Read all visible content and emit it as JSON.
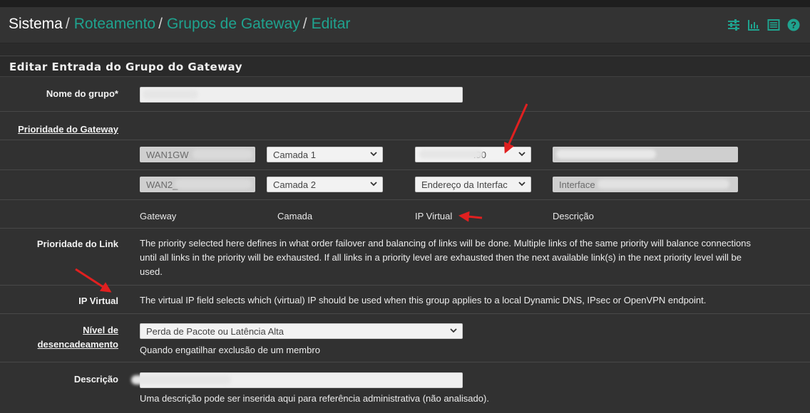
{
  "breadcrumb": {
    "root": "Sistema",
    "items": [
      "Roteamento",
      "Grupos de Gateway",
      "Editar"
    ],
    "separator": "/"
  },
  "header_icons": [
    "sliders-icon",
    "bar-chart-icon",
    "list-icon",
    "help-icon"
  ],
  "colors": {
    "accent": "#1fa38f",
    "arrow": "#e02020",
    "panel": "#2f2f2f"
  },
  "panel": {
    "title": "Editar Entrada do Grupo do Gateway",
    "group_name": {
      "label": "Nome do grupo*",
      "value": ""
    },
    "gateway_priority": {
      "label": "Prioridade do Gateway",
      "rows": [
        {
          "gateway": "WAN1GW",
          "tier": "Camada 1",
          "virtual_ip": ".90",
          "description": ""
        },
        {
          "gateway": "WAN2_",
          "tier": "Camada 2",
          "virtual_ip": "Endereço da Interfac",
          "description": "Interface"
        }
      ],
      "columns": [
        "Gateway",
        "Camada",
        "IP Virtual",
        "Descrição"
      ]
    },
    "link_priority": {
      "label": "Prioridade do Link",
      "help_lines": [
        "The priority selected here defines in what order failover and balancing of links will be done. Multiple links of the same priority will balance connections",
        "until all links in the priority will be exhausted. If all links in a priority level are exhausted then the next available link(s) in the next priority level will be",
        "used."
      ]
    },
    "virtual_ip": {
      "label": "IP Virtual",
      "help": "The virtual IP field selects which (virtual) IP should be used when this group applies to a local Dynamic DNS, IPsec or OpenVPN endpoint."
    },
    "trigger_level": {
      "label_line1": "Nível de",
      "label_line2": "desencadeamento",
      "selected": "Perda de Pacote ou Latência Alta",
      "help": "Quando engatilhar exclusão de um membro"
    },
    "description": {
      "label": "Descrição",
      "value": "",
      "help": "Uma descrição pode ser inserida aqui para referência administrativa (não analisado)."
    }
  }
}
